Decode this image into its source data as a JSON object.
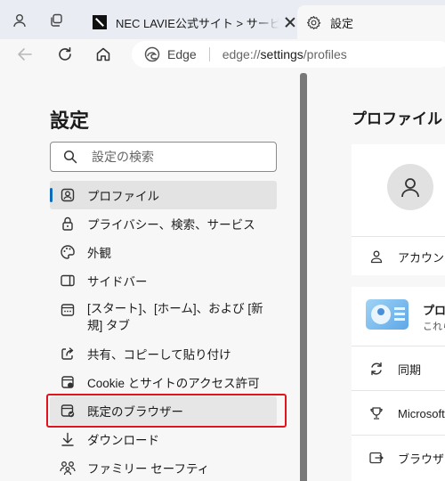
{
  "browser": {
    "tabs": [
      {
        "title": "NEC LAVIE公式サイト > サービス&サポート",
        "active": false
      },
      {
        "title": "設定",
        "active": true
      }
    ],
    "address": {
      "site_label": "Edge",
      "url_scheme": "edge://",
      "url_strong": "settings",
      "url_rest": "/profiles"
    }
  },
  "sidebar": {
    "title": "設定",
    "search_placeholder": "設定の検索",
    "items": [
      {
        "label": "プロファイル",
        "icon": "profile-icon",
        "selected": true
      },
      {
        "label": "プライバシー、検索、サービス",
        "icon": "lock-icon"
      },
      {
        "label": "外観",
        "icon": "palette-icon"
      },
      {
        "label": "サイドバー",
        "icon": "sidebar-icon"
      },
      {
        "label": "[スタート]、[ホーム]、および [新規] タブ",
        "icon": "home-tabs-icon"
      },
      {
        "label": "共有、コピーして貼り付け",
        "icon": "share-icon"
      },
      {
        "label": "Cookie とサイトのアクセス許可",
        "icon": "cookie-permissions-icon"
      },
      {
        "label": "既定のブラウザー",
        "icon": "default-browser-icon",
        "highlighted": true
      },
      {
        "label": "ダウンロード",
        "icon": "download-icon"
      },
      {
        "label": "ファミリー セーフティ",
        "icon": "family-icon"
      }
    ]
  },
  "main": {
    "title": "プロファイル",
    "account_row": "アカウント",
    "promo_title": "プロフ",
    "promo_sub": "これら",
    "rows": [
      {
        "label": "同期",
        "icon": "sync-icon"
      },
      {
        "label": "Microsoft",
        "icon": "rewards-icon"
      },
      {
        "label": "ブラウザー",
        "icon": "import-icon"
      }
    ]
  },
  "colors": {
    "accent": "#0f6cbd",
    "highlight_frame": "#e0141e",
    "scrollbar": "#787878"
  }
}
